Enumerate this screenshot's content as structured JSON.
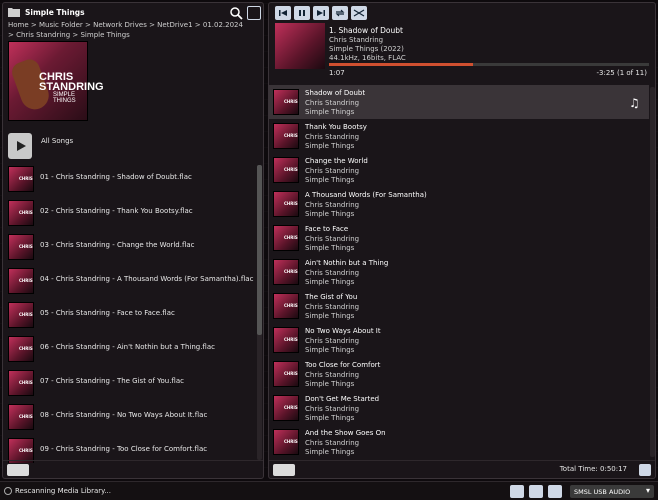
{
  "left": {
    "title": "Simple Things",
    "breadcrumb": "Home > Music Folder > Network Drives > NetDrive1 > 01.02.2024 > Chris Standring > Simple Things",
    "album_art_text": {
      "artist": "CHRIS STANDRING",
      "album": "SIMPLE THINGS"
    },
    "all_songs": "All Songs",
    "files": [
      "01 - Chris Standring - Shadow of Doubt.flac",
      "02 - Chris Standring - Thank You Bootsy.flac",
      "03 - Chris Standring - Change the World.flac",
      "04 - Chris Standring - A Thousand Words (For Samantha).flac",
      "05 - Chris Standring - Face to Face.flac",
      "06 - Chris Standring - Ain't Nothin but a Thing.flac",
      "07 - Chris Standring - The Gist of You.flac",
      "08 - Chris Standring - No Two Ways About It.flac",
      "09 - Chris Standring - Too Close for Comfort.flac"
    ]
  },
  "now_playing": {
    "title": "1. Shadow of Doubt",
    "artist": "Chris Standring",
    "album": "Simple Things (2022)",
    "format": "44.1kHz, 16bits, FLAC",
    "elapsed": "1:07",
    "remaining": "-3:25 (1 of 11)",
    "progress": 0.45
  },
  "queue": [
    {
      "title": "Shadow of Doubt",
      "artist": "Chris Standring",
      "album": "Simple Things"
    },
    {
      "title": "Thank You Bootsy",
      "artist": "Chris Standring",
      "album": "Simple Things"
    },
    {
      "title": "Change the World",
      "artist": "Chris Standring",
      "album": "Simple Things"
    },
    {
      "title": "A Thousand Words (For Samantha)",
      "artist": "Chris Standring",
      "album": "Simple Things"
    },
    {
      "title": "Face to Face",
      "artist": "Chris Standring",
      "album": "Simple Things"
    },
    {
      "title": "Ain't Nothin but a Thing",
      "artist": "Chris Standring",
      "album": "Simple Things"
    },
    {
      "title": "The Gist of You",
      "artist": "Chris Standring",
      "album": "Simple Things"
    },
    {
      "title": "No Two Ways About It",
      "artist": "Chris Standring",
      "album": "Simple Things"
    },
    {
      "title": "Too Close for Comfort",
      "artist": "Chris Standring",
      "album": "Simple Things"
    },
    {
      "title": "Don't Get Me Started",
      "artist": "Chris Standring",
      "album": "Simple Things"
    },
    {
      "title": "And the Show Goes On",
      "artist": "Chris Standring",
      "album": "Simple Things"
    }
  ],
  "total_time": "Total Time: 0:50:17",
  "status": {
    "message": "Rescanning Media Library...",
    "device": "SMSL USB AUDIO"
  },
  "colors": {
    "accent": "#d05030",
    "button": "#cfd8e6"
  }
}
